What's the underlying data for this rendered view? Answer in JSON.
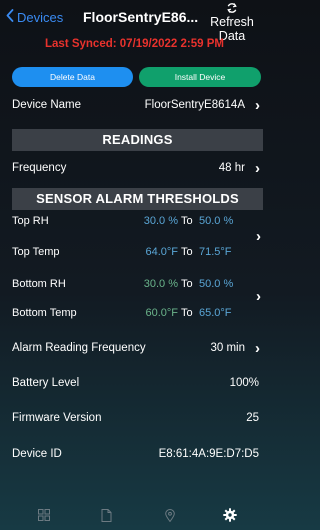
{
  "header": {
    "back_label": "Devices",
    "title": "FloorSentryE86...",
    "refresh_label": "Refresh Data",
    "last_synced": "Last Synced: 07/19/2022 2:59 PM"
  },
  "actions": {
    "delete_label": "Delete Data",
    "install_label": "Install Device"
  },
  "device_name": {
    "label": "Device Name",
    "value": "FloorSentryE8614A"
  },
  "readings": {
    "heading": "READINGS",
    "frequency": {
      "label": "Frequency",
      "value": "48 hr"
    }
  },
  "thresholds": {
    "heading": "SENSOR ALARM THRESHOLDS",
    "to_label": "To",
    "rows": [
      {
        "label": "Top RH",
        "low": "30.0 %",
        "high": "50.0 %"
      },
      {
        "label": "Top Temp",
        "low": "64.0°F",
        "high": "71.5°F"
      },
      {
        "label": "Bottom RH",
        "low": "30.0 %",
        "high": "50.0 %"
      },
      {
        "label": "Bottom Temp",
        "low": "60.0°F",
        "high": "65.0°F"
      }
    ]
  },
  "alarm_reading_frequency": {
    "label": "Alarm Reading Frequency",
    "value": "30 min"
  },
  "battery_level": {
    "label": "Battery Level",
    "value": "100%"
  },
  "firmware_version": {
    "label": "Firmware Version",
    "value": "25"
  },
  "device_id": {
    "label": "Device ID",
    "value": "E8:61:4A:9E:D7:D5"
  },
  "tabbar": {
    "icons": [
      "grid-icon",
      "document-icon",
      "location-pin-icon",
      "gear-icon"
    ],
    "active": "gear-icon"
  },
  "colors": {
    "accent_blue": "#1e8ff0",
    "install_green": "#10a06c",
    "synced_red": "#e8322d",
    "value_blue": "#5aa6d6",
    "value_green": "#6ab48b"
  }
}
